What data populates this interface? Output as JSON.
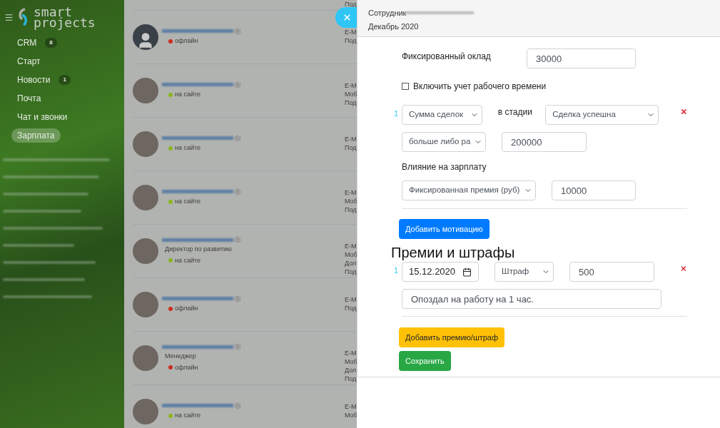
{
  "sidebar": {
    "logo_lines": [
      "smart",
      "projects"
    ],
    "items": [
      {
        "label": "CRM",
        "badge": "8",
        "selected": false
      },
      {
        "label": "Старт",
        "selected": false
      },
      {
        "label": "Новости",
        "badge": "1",
        "selected": false
      },
      {
        "label": "Почта",
        "selected": false
      },
      {
        "label": "Чат и звонки",
        "selected": false
      },
      {
        "label": "Зарплата",
        "selected": true
      }
    ]
  },
  "top_partial_detail": "Под",
  "employees": [
    {
      "kind": "silhouette",
      "status": "офлайн",
      "color": "#cc2b1d",
      "details": [
        "E-M",
        "Под"
      ]
    },
    {
      "kind": "photo",
      "status": "на сайте",
      "color": "#8cb51c",
      "details": [
        "E-M",
        "Моб",
        "Под"
      ]
    },
    {
      "kind": "photo",
      "status": "на сайте",
      "color": "#8cb51c",
      "details": [
        "E-M",
        "Под"
      ]
    },
    {
      "kind": "photo",
      "status": "на сайте",
      "color": "#8cb51c",
      "details": [
        "E-M",
        "Моб",
        "Под"
      ]
    },
    {
      "kind": "photo",
      "position": "Директор по развитию",
      "status": "на сайте",
      "color": "#8cb51c",
      "details": [
        "E-M",
        "Моб",
        "Дол",
        "Под"
      ]
    },
    {
      "kind": "photo",
      "status": "офлайн",
      "color": "#cc2b1d",
      "details": [
        "E-M",
        "Под"
      ]
    },
    {
      "kind": "photo",
      "position": "Менеджер",
      "status": "офлайн",
      "color": "#cc2b1d",
      "details": [
        "E-M",
        "Моб",
        "Дол",
        "Под"
      ]
    },
    {
      "kind": "photo",
      "status": "на сайте",
      "color": "#8cb51c",
      "details": [
        "E-M",
        "Моб"
      ]
    }
  ],
  "panel": {
    "title": "Сотрудник",
    "subtitle": "Декабрь 2020",
    "salary": {
      "label": "Фиксированный оклад",
      "value": "30000"
    },
    "timesheet": {
      "label": "Включить учет рабочего времени",
      "checked": false
    },
    "motivations": [
      {
        "number": "1",
        "metric": "Сумма сделок",
        "stage_label": "в стадии",
        "stage": "Сделка успешна",
        "condition": "больше либо ра",
        "threshold": "200000",
        "effect_label": "Влияние на зарплату",
        "effect": "Фиксированная премия (руб)",
        "amount": "10000"
      }
    ],
    "add_motivation": "Добавить мотивацию",
    "bonuses_title": "Премии и штрафы",
    "bonuses": [
      {
        "number": "1",
        "date": "15.12.2020",
        "type": "Штраф",
        "amount": "500",
        "comment": "Опоздал на работу на 1 час."
      }
    ],
    "add_bonus": "Добавить премию/штраф",
    "save": "Сохранить"
  }
}
